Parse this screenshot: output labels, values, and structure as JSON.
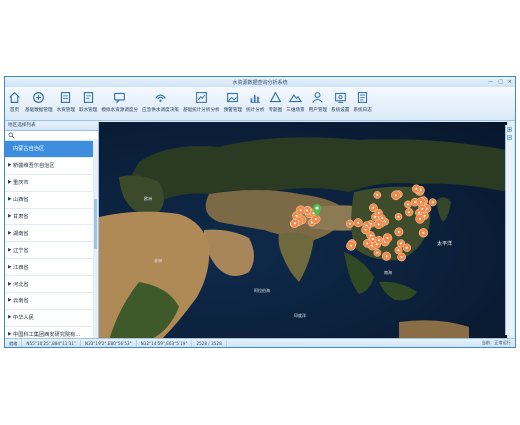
{
  "window": {
    "title": "水资源数据查询分析系统",
    "controls": [
      "—",
      "□",
      "×"
    ]
  },
  "toolbar": {
    "buttons": [
      {
        "label": "首页",
        "icon": "home-icon"
      },
      {
        "label": "基础数据管理",
        "icon": "database-icon"
      },
      {
        "label": "水资管理",
        "icon": "document-icon"
      },
      {
        "label": "取水管理",
        "icon": "document-icon"
      },
      {
        "label": "模拟水资源调度分",
        "icon": "chat-icon"
      },
      {
        "label": "应急供水调度决策",
        "icon": "signal-icon"
      },
      {
        "label": "基础统计分析分析",
        "icon": "chart-icon"
      },
      {
        "label": "预警管理",
        "icon": "image-icon"
      },
      {
        "label": "统计分析",
        "icon": "bar-chart-icon"
      },
      {
        "label": "专题图",
        "icon": "triangle-icon"
      },
      {
        "label": "三维场景",
        "icon": "mountain-icon"
      },
      {
        "label": "用户管理",
        "icon": "user-icon"
      },
      {
        "label": "系统设置",
        "icon": "gear-icon"
      },
      {
        "label": "系统日志",
        "icon": "log-icon"
      }
    ]
  },
  "sidebar": {
    "header": "地区选择列表",
    "items": [
      {
        "label": "内蒙古自治区",
        "selected": true
      },
      {
        "label": "新疆维吾尔自治区",
        "selected": false
      },
      {
        "label": "重庆市",
        "selected": false
      },
      {
        "label": "山西省",
        "selected": false
      },
      {
        "label": "甘肃省",
        "selected": false
      },
      {
        "label": "湖南省",
        "selected": false
      },
      {
        "label": "辽宁省",
        "selected": false
      },
      {
        "label": "江西省",
        "selected": false
      },
      {
        "label": "河北省",
        "selected": false
      },
      {
        "label": "云南省",
        "selected": false
      },
      {
        "label": "中华人民",
        "selected": false
      },
      {
        "label": "中国科工集团西安研究院有...",
        "selected": false
      }
    ]
  },
  "map": {
    "labels": {
      "pacific": "太平洋",
      "arabian_sea": "阿拉伯海",
      "indian_ocean": "印度洋",
      "south_china_sea": "南海",
      "africa": "非洲",
      "europe": "欧洲"
    },
    "marker_color": "#f08a4b",
    "cluster_markers": 64
  },
  "statusbar": {
    "status": "就绪",
    "coord1": "N55°10'25\",884°11'31\"",
    "coord2": "N33°19'2\",E80°56'53\"",
    "coord3": "N32°14'59\",E63°5'19\"",
    "scale": "2528 / 2528",
    "right": "当前：正常运行"
  },
  "colors": {
    "accent": "#3e8ee0",
    "ocean": "#0c2240",
    "land_dark": "#25331d",
    "land_desert": "#a08358",
    "marker": "#f08a4b"
  }
}
